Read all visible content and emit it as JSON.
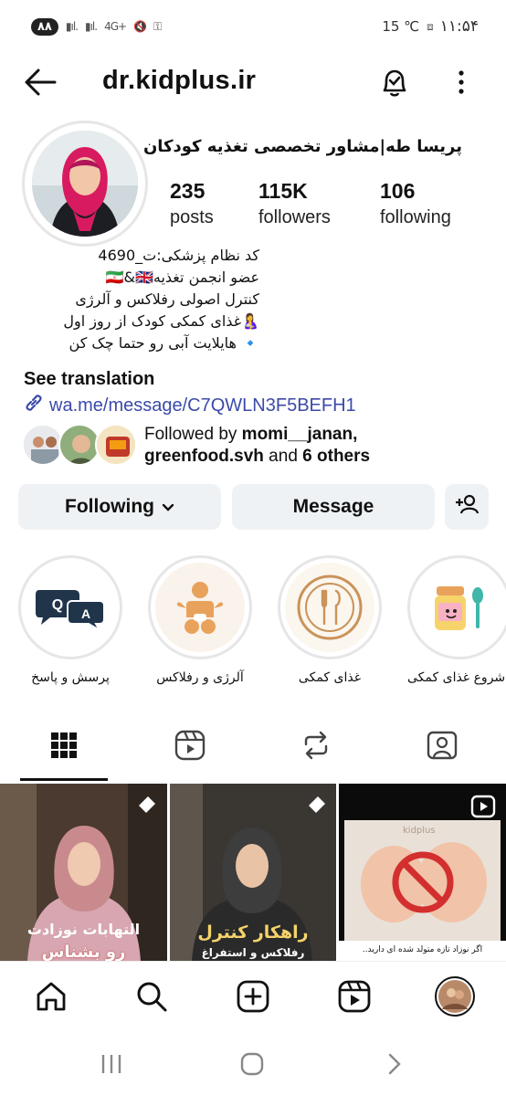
{
  "status_bar": {
    "battery": "۸۸",
    "network": "4G+",
    "right_info": "15 ℃",
    "time": "۱۱:۵۴"
  },
  "header": {
    "username": "dr.kidplus.ir"
  },
  "profile": {
    "full_name": "پریسا طه|مشاور تخصصی تغذیه کودکان",
    "stats": [
      {
        "value": "235",
        "label": "posts"
      },
      {
        "value": "115K",
        "label": "followers"
      },
      {
        "value": "106",
        "label": "following"
      }
    ],
    "bio_lines": [
      "کد نظام پزشکی:ت_4690",
      "عضو انجمن تغذیه🇮🇷&🇬🇧",
      "کنترل اصولی رفلاکس و آلرژی",
      "🤱غذای کمکی کودک از روز اول",
      "🔹 هایلایت آبی رو حتما چک کن"
    ],
    "see_translation": "See translation",
    "link": "wa.me/message/C7QWLN3F5BEFH1",
    "followed_by": {
      "prefix": "Followed by ",
      "user1": "momi__janan,",
      "user2": "greenfood.svh",
      "middle": " and ",
      "others": "6 others"
    }
  },
  "actions": {
    "following": "Following",
    "message": "Message"
  },
  "highlights": [
    {
      "label": "پرسش و پاسخ",
      "icon": "qa-bubbles-icon"
    },
    {
      "label": "آلرژی و رفلاکس",
      "icon": "baby-icon"
    },
    {
      "label": "غذای کمکی",
      "icon": "plate-cutlery-icon"
    },
    {
      "label": "شروع غذای کمکی",
      "icon": "baby-food-jar-icon"
    }
  ],
  "tabs": [
    "grid-icon",
    "reels-icon",
    "reposts-icon",
    "tagged-icon"
  ],
  "posts": [
    {
      "caption": "التهابات نوزادت",
      "caption2": "رو بشناس"
    },
    {
      "caption": "راهکار کنترل",
      "caption2": "رفلاکس و استفراغ"
    },
    {
      "caption": "اگر نوزاد تازه متولد شده ای دارید..",
      "watermark": "kidplus"
    }
  ],
  "colors": {
    "link": "#3b4aa8",
    "button_bg": "#eff2f5",
    "accent_orange": "#e8a25c"
  }
}
